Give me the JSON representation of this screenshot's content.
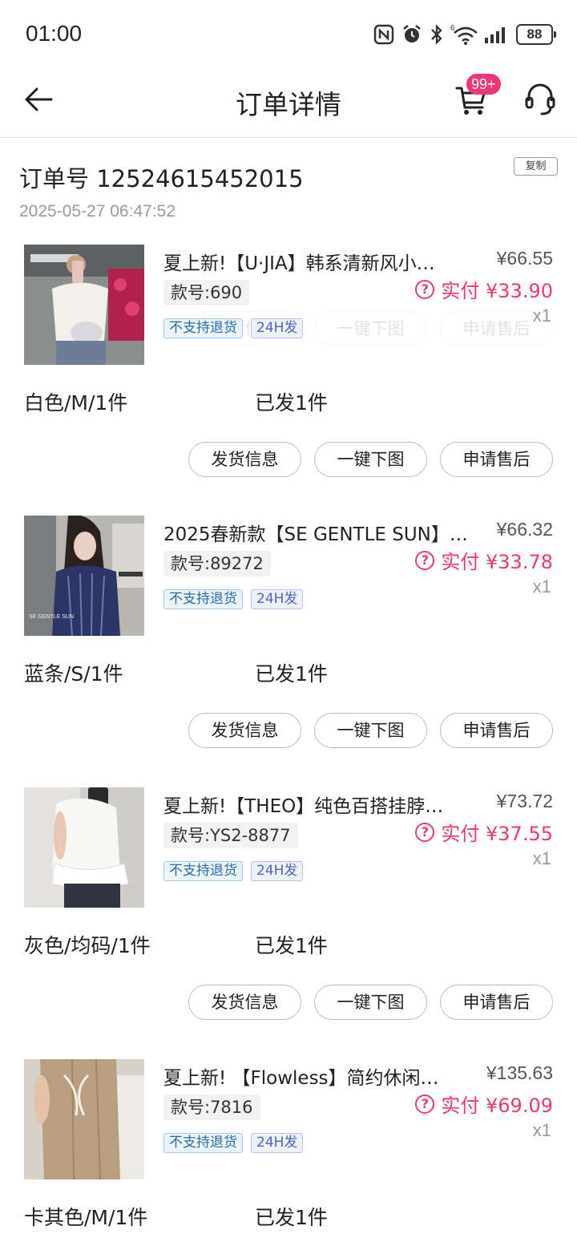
{
  "status_bar": {
    "time": "01:00",
    "battery": "88"
  },
  "header": {
    "title": "订单详情",
    "cart_badge": "99+"
  },
  "order": {
    "number_label": "订单号 12524615452015",
    "date": "2025-05-27 06:47:52",
    "copy_label": "复制"
  },
  "actions": {
    "ship_info": "发货信息",
    "download_images": "一键下图",
    "after_sale": "申请售后"
  },
  "items": [
    {
      "name": "夏上新!【U·JIA】韩系清新风小…",
      "original_price": "¥66.55",
      "style_no": "款号:690",
      "paid": "实付 ¥33.90",
      "qty": "x1",
      "tags": [
        "不支持退货",
        "24H发"
      ],
      "spec": "白色/M/1件",
      "shipped": "已发1件"
    },
    {
      "name": "2025春新款【SE GENTLE SUN】…",
      "original_price": "¥66.32",
      "style_no": "款号:89272",
      "paid": "实付 ¥33.78",
      "qty": "x1",
      "tags": [
        "不支持退货",
        "24H发"
      ],
      "spec": "蓝条/S/1件",
      "shipped": "已发1件"
    },
    {
      "name": "夏上新!【THEO】纯色百搭挂脖…",
      "original_price": "¥73.72",
      "style_no": "款号:YS2-8877",
      "paid": "实付 ¥37.55",
      "qty": "x1",
      "tags": [
        "不支持退货",
        "24H发"
      ],
      "spec": "灰色/均码/1件",
      "shipped": "已发1件"
    },
    {
      "name": "夏上新! 【Flowless】简约休闲…",
      "original_price": "¥135.63",
      "style_no": "款号:7816",
      "paid": "实付 ¥69.09",
      "qty": "x1",
      "tags": [
        "不支持退货",
        "24H发"
      ],
      "spec": "卡其色/M/1件",
      "shipped": "已发1件"
    }
  ]
}
